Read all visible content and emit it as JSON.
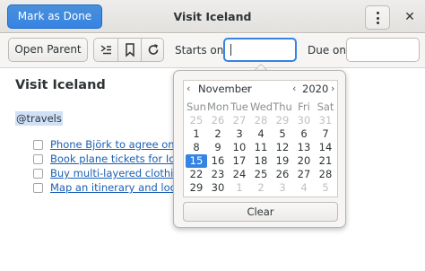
{
  "header": {
    "mark_done_label": "Mark as Done",
    "title": "Visit Iceland",
    "menu_icon": "vertical-dots-icon",
    "close_icon": "close-icon",
    "accent_color": "#3584e4"
  },
  "toolbar": {
    "open_parent_label": "Open Parent",
    "icons": [
      "subtask-icon",
      "bookmark-icon",
      "refresh-icon"
    ],
    "starts_on_label": "Starts on",
    "starts_on_value": "",
    "due_on_label": "Due on",
    "due_on_value": ""
  },
  "task": {
    "title": "Visit Iceland",
    "tag": "@travels",
    "checklist": [
      "Phone Björk to agree on a m",
      "Book plane tickets for Icelan",
      "Buy multi-layered clothing (",
      "Map an itinerary and look at"
    ]
  },
  "calendar": {
    "month": "November",
    "year": "2020",
    "weekdays": [
      "Sun",
      "Mon",
      "Tue",
      "Wed",
      "Thu",
      "Fri",
      "Sat"
    ],
    "weeks": [
      [
        "25",
        "26",
        "27",
        "28",
        "29",
        "30",
        "31"
      ],
      [
        "1",
        "2",
        "3",
        "4",
        "5",
        "6",
        "7"
      ],
      [
        "8",
        "9",
        "10",
        "11",
        "12",
        "13",
        "14"
      ],
      [
        "15",
        "16",
        "17",
        "18",
        "19",
        "20",
        "21"
      ],
      [
        "22",
        "23",
        "24",
        "25",
        "26",
        "27",
        "28"
      ],
      [
        "29",
        "30",
        "1",
        "2",
        "3",
        "4",
        "5"
      ]
    ],
    "selected_day": "15",
    "clear_label": "Clear"
  }
}
